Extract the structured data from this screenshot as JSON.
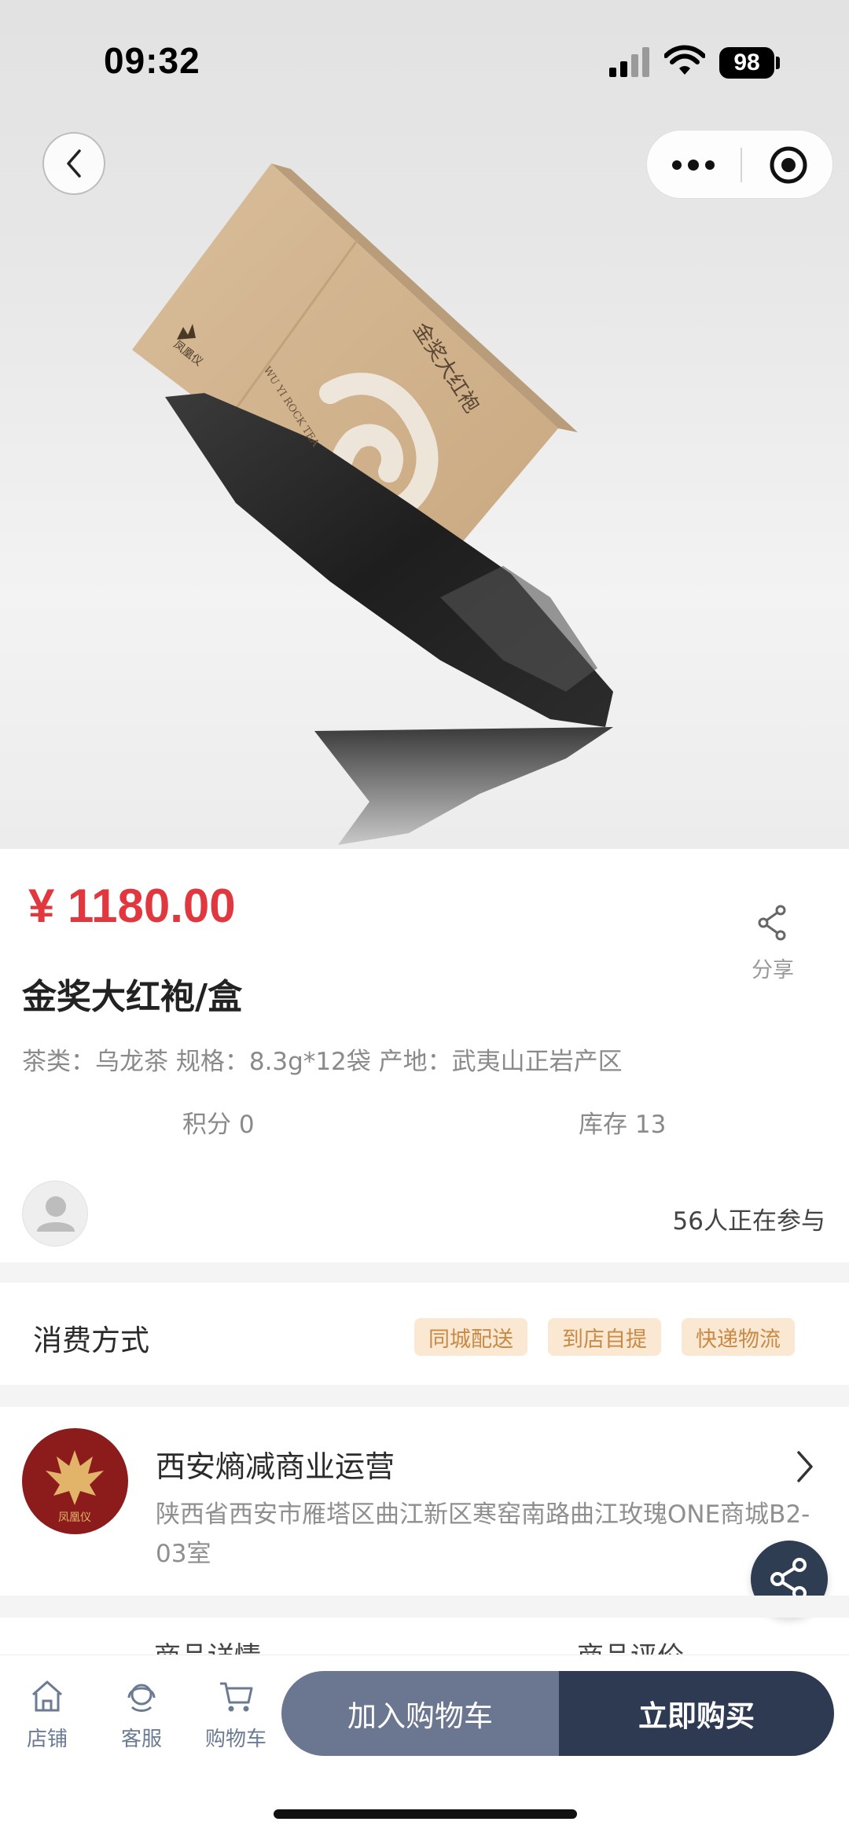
{
  "status_bar": {
    "time": "09:32",
    "battery": "98"
  },
  "product": {
    "price": "¥ 1180.00",
    "title": "金奖大红袍/盒",
    "specs": "茶类：乌龙茶 规格：8.3g*12袋 产地：武夷山正岩产区",
    "points": "积分 0",
    "stock": "库存 13",
    "share_label": "分享",
    "participants": "56人正在参与",
    "box_text_vertical": "金奖大红袍",
    "box_text_english": "WU YI ROCK TEA",
    "box_brand": "凤凰仪"
  },
  "consumption": {
    "label": "消费方式",
    "options": [
      "同城配送",
      "到店自提",
      "快递物流"
    ]
  },
  "store": {
    "name": "西安熵减商业运营",
    "address": "陕西省西安市雁塔区曲江新区寒窑南路曲江玫瑰ONE商城B2-03室",
    "logo_text": "凤凰仪"
  },
  "tabs": [
    "商品详情",
    "商品评价"
  ],
  "bottom_nav": {
    "items": [
      {
        "label": "店铺",
        "icon": "store-icon"
      },
      {
        "label": "客服",
        "icon": "customer-service-icon"
      },
      {
        "label": "购物车",
        "icon": "cart-icon"
      }
    ],
    "add_to_cart": "加入购物车",
    "buy_now": "立即购买"
  },
  "colors": {
    "price": "#e0383e",
    "tag_bg": "#fbe8d2",
    "tag_text": "#c88a45",
    "cart_button": "#6b7791",
    "buy_button": "#2e3a52",
    "logo_bg": "#8c1c1c"
  }
}
